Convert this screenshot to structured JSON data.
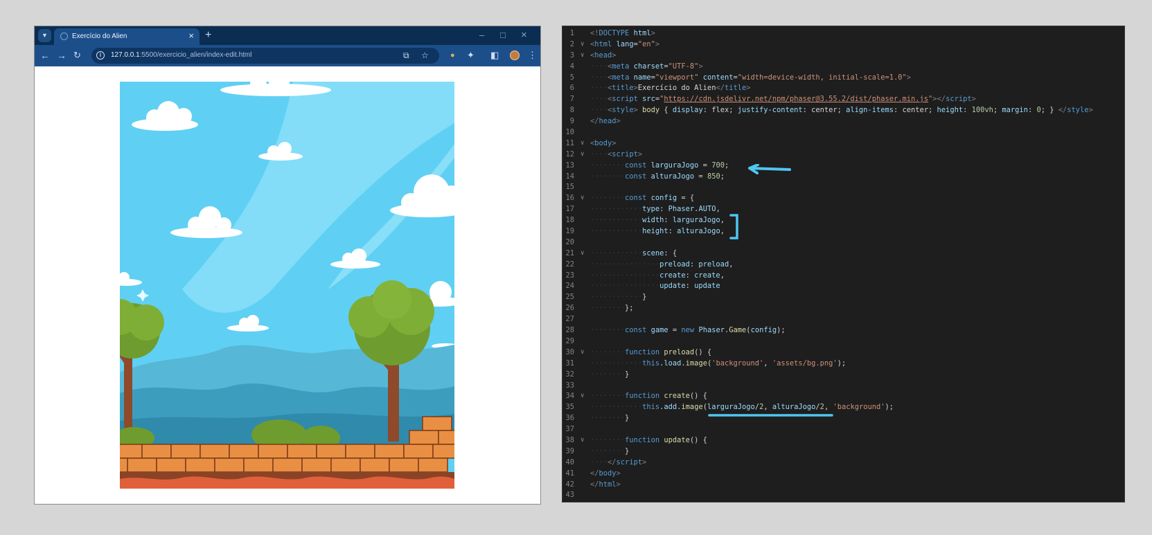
{
  "browser": {
    "tab_title": "Exercício do Alien",
    "url_host": "127.0.0.1",
    "url_rest": ":5500/exercicio_alien/index-edit.html",
    "icons": {
      "tab_menu": "chevron-down-icon",
      "favicon": "globe-icon",
      "tab_close": "close-icon",
      "new_tab": "plus-icon",
      "minimize": "minimize-icon",
      "maximize": "maximize-icon",
      "close_window": "close-icon",
      "back": "arrow-left-icon",
      "forward": "arrow-right-icon",
      "reload": "reload-icon",
      "site_info": "info-icon",
      "translate": "translate-icon",
      "bookmark": "star-icon",
      "extension_pin": "pin-icon",
      "extensions": "puzzle-icon",
      "side_panel": "side-panel-icon",
      "profile": "avatar-icon",
      "menu": "kebab-menu-icon"
    },
    "colors": {
      "tabbar": "#0b2d52",
      "toolbar": "#1c4f8a",
      "sky": "#5fd0f3"
    }
  },
  "editor": {
    "lines": [
      {
        "n": "1",
        "fold": false,
        "indent": 0,
        "tokens": [
          [
            "punc",
            "<!"
          ],
          [
            "tag",
            "DOCTYPE"
          ],
          [
            "plain",
            " "
          ],
          [
            "attr",
            "html"
          ],
          [
            "punc",
            ">"
          ]
        ]
      },
      {
        "n": "2",
        "fold": true,
        "indent": 0,
        "tokens": [
          [
            "punc",
            "<"
          ],
          [
            "tag",
            "html"
          ],
          [
            "plain",
            " "
          ],
          [
            "attr",
            "lang"
          ],
          [
            "plain",
            "="
          ],
          [
            "str",
            "\"en\""
          ],
          [
            "punc",
            ">"
          ]
        ]
      },
      {
        "n": "3",
        "fold": true,
        "indent": 0,
        "tokens": [
          [
            "punc",
            "<"
          ],
          [
            "tag",
            "head"
          ],
          [
            "punc",
            ">"
          ]
        ]
      },
      {
        "n": "4",
        "fold": false,
        "indent": 1,
        "tokens": [
          [
            "punc",
            "<"
          ],
          [
            "tag",
            "meta"
          ],
          [
            "plain",
            " "
          ],
          [
            "attr",
            "charset"
          ],
          [
            "plain",
            "="
          ],
          [
            "str",
            "\"UTF-8\""
          ],
          [
            "punc",
            ">"
          ]
        ]
      },
      {
        "n": "5",
        "fold": false,
        "indent": 1,
        "tokens": [
          [
            "punc",
            "<"
          ],
          [
            "tag",
            "meta"
          ],
          [
            "plain",
            " "
          ],
          [
            "attr",
            "name"
          ],
          [
            "plain",
            "="
          ],
          [
            "str",
            "\"viewport\""
          ],
          [
            "plain",
            " "
          ],
          [
            "attr",
            "content"
          ],
          [
            "plain",
            "="
          ],
          [
            "str",
            "\"width=device-width, initial-scale=1.0\""
          ],
          [
            "punc",
            ">"
          ]
        ]
      },
      {
        "n": "6",
        "fold": false,
        "indent": 1,
        "tokens": [
          [
            "punc",
            "<"
          ],
          [
            "tag",
            "title"
          ],
          [
            "punc",
            ">"
          ],
          [
            "plain",
            "Exercício do Alien"
          ],
          [
            "punc",
            "</"
          ],
          [
            "tag",
            "title"
          ],
          [
            "punc",
            ">"
          ]
        ]
      },
      {
        "n": "7",
        "fold": false,
        "indent": 1,
        "tokens": [
          [
            "punc",
            "<"
          ],
          [
            "tag",
            "script"
          ],
          [
            "plain",
            " "
          ],
          [
            "attr",
            "src"
          ],
          [
            "plain",
            "="
          ],
          [
            "str",
            "\""
          ],
          [
            "url",
            "https://cdn.jsdelivr.net/npm/phaser@3.55.2/dist/phaser.min.js"
          ],
          [
            "str",
            "\""
          ],
          [
            "punc",
            "></"
          ],
          [
            "tag",
            "script"
          ],
          [
            "punc",
            ">"
          ]
        ]
      },
      {
        "n": "8",
        "fold": false,
        "indent": 1,
        "tokens": [
          [
            "punc",
            "<"
          ],
          [
            "tag",
            "style"
          ],
          [
            "punc",
            "> "
          ],
          [
            "fn",
            "body"
          ],
          [
            "plain",
            " { "
          ],
          [
            "attr",
            "display"
          ],
          [
            "plain",
            ": flex; "
          ],
          [
            "attr",
            "justify-content"
          ],
          [
            "plain",
            ": center; "
          ],
          [
            "attr",
            "align-items"
          ],
          [
            "plain",
            ": center; "
          ],
          [
            "attr",
            "height"
          ],
          [
            "plain",
            ": "
          ],
          [
            "num",
            "100vh"
          ],
          [
            "plain",
            "; "
          ],
          [
            "attr",
            "margin"
          ],
          [
            "plain",
            ": "
          ],
          [
            "num",
            "0"
          ],
          [
            "plain",
            "; } "
          ],
          [
            "punc",
            "</"
          ],
          [
            "tag",
            "style"
          ],
          [
            "punc",
            ">"
          ]
        ]
      },
      {
        "n": "9",
        "fold": false,
        "indent": 0,
        "tokens": [
          [
            "punc",
            "</"
          ],
          [
            "tag",
            "head"
          ],
          [
            "punc",
            ">"
          ]
        ]
      },
      {
        "n": "10",
        "fold": false,
        "indent": 0,
        "tokens": []
      },
      {
        "n": "11",
        "fold": true,
        "indent": 0,
        "tokens": [
          [
            "punc",
            "<"
          ],
          [
            "tag",
            "body"
          ],
          [
            "punc",
            ">"
          ]
        ]
      },
      {
        "n": "12",
        "fold": true,
        "indent": 1,
        "tokens": [
          [
            "punc",
            "<"
          ],
          [
            "tag",
            "script"
          ],
          [
            "punc",
            ">"
          ]
        ]
      },
      {
        "n": "13",
        "fold": false,
        "indent": 2,
        "tokens": [
          [
            "kw",
            "const"
          ],
          [
            "plain",
            " "
          ],
          [
            "var",
            "larguraJogo"
          ],
          [
            "plain",
            " = "
          ],
          [
            "num",
            "700"
          ],
          [
            "plain",
            ";"
          ]
        ]
      },
      {
        "n": "14",
        "fold": false,
        "indent": 2,
        "tokens": [
          [
            "kw",
            "const"
          ],
          [
            "plain",
            " "
          ],
          [
            "var",
            "alturaJogo"
          ],
          [
            "plain",
            " = "
          ],
          [
            "num",
            "850"
          ],
          [
            "plain",
            ";"
          ]
        ]
      },
      {
        "n": "15",
        "fold": false,
        "indent": 0,
        "tokens": []
      },
      {
        "n": "16",
        "fold": true,
        "indent": 2,
        "tokens": [
          [
            "kw",
            "const"
          ],
          [
            "plain",
            " "
          ],
          [
            "var",
            "config"
          ],
          [
            "plain",
            " = {"
          ]
        ]
      },
      {
        "n": "17",
        "fold": false,
        "indent": 3,
        "tokens": [
          [
            "var",
            "type"
          ],
          [
            "plain",
            ": "
          ],
          [
            "var",
            "Phaser"
          ],
          [
            "plain",
            "."
          ],
          [
            "var",
            "AUTO"
          ],
          [
            "plain",
            ","
          ]
        ]
      },
      {
        "n": "18",
        "fold": false,
        "indent": 3,
        "tokens": [
          [
            "var",
            "width"
          ],
          [
            "plain",
            ": "
          ],
          [
            "var",
            "larguraJogo"
          ],
          [
            "plain",
            ","
          ]
        ]
      },
      {
        "n": "19",
        "fold": false,
        "indent": 3,
        "tokens": [
          [
            "var",
            "height"
          ],
          [
            "plain",
            ": "
          ],
          [
            "var",
            "alturaJogo"
          ],
          [
            "plain",
            ","
          ]
        ]
      },
      {
        "n": "20",
        "fold": false,
        "indent": 0,
        "tokens": []
      },
      {
        "n": "21",
        "fold": true,
        "indent": 3,
        "tokens": [
          [
            "var",
            "scene"
          ],
          [
            "plain",
            ": {"
          ]
        ]
      },
      {
        "n": "22",
        "fold": false,
        "indent": 4,
        "tokens": [
          [
            "var",
            "preload"
          ],
          [
            "plain",
            ": "
          ],
          [
            "var",
            "preload"
          ],
          [
            "plain",
            ","
          ]
        ]
      },
      {
        "n": "23",
        "fold": false,
        "indent": 4,
        "tokens": [
          [
            "var",
            "create"
          ],
          [
            "plain",
            ": "
          ],
          [
            "var",
            "create"
          ],
          [
            "plain",
            ","
          ]
        ]
      },
      {
        "n": "24",
        "fold": false,
        "indent": 4,
        "tokens": [
          [
            "var",
            "update"
          ],
          [
            "plain",
            ": "
          ],
          [
            "var",
            "update"
          ]
        ]
      },
      {
        "n": "25",
        "fold": false,
        "indent": 3,
        "tokens": [
          [
            "plain",
            "}"
          ]
        ]
      },
      {
        "n": "26",
        "fold": false,
        "indent": 2,
        "tokens": [
          [
            "plain",
            "};"
          ]
        ]
      },
      {
        "n": "27",
        "fold": false,
        "indent": 0,
        "tokens": []
      },
      {
        "n": "28",
        "fold": false,
        "indent": 2,
        "tokens": [
          [
            "kw",
            "const"
          ],
          [
            "plain",
            " "
          ],
          [
            "var",
            "game"
          ],
          [
            "plain",
            " = "
          ],
          [
            "kw",
            "new"
          ],
          [
            "plain",
            " "
          ],
          [
            "var",
            "Phaser"
          ],
          [
            "plain",
            "."
          ],
          [
            "fn",
            "Game"
          ],
          [
            "plain",
            "("
          ],
          [
            "var",
            "config"
          ],
          [
            "plain",
            ");"
          ]
        ]
      },
      {
        "n": "29",
        "fold": false,
        "indent": 0,
        "tokens": []
      },
      {
        "n": "30",
        "fold": true,
        "indent": 2,
        "tokens": [
          [
            "kw",
            "function"
          ],
          [
            "plain",
            " "
          ],
          [
            "fn",
            "preload"
          ],
          [
            "plain",
            "() {"
          ]
        ]
      },
      {
        "n": "31",
        "fold": false,
        "indent": 3,
        "tokens": [
          [
            "kw",
            "this"
          ],
          [
            "plain",
            "."
          ],
          [
            "var",
            "load"
          ],
          [
            "plain",
            "."
          ],
          [
            "fn",
            "image"
          ],
          [
            "plain",
            "("
          ],
          [
            "str",
            "'background'"
          ],
          [
            "plain",
            ", "
          ],
          [
            "str",
            "'assets/bg.png'"
          ],
          [
            "plain",
            ");"
          ]
        ]
      },
      {
        "n": "32",
        "fold": false,
        "indent": 2,
        "tokens": [
          [
            "plain",
            "}"
          ]
        ]
      },
      {
        "n": "33",
        "fold": false,
        "indent": 0,
        "tokens": []
      },
      {
        "n": "34",
        "fold": true,
        "indent": 2,
        "tokens": [
          [
            "kw",
            "function"
          ],
          [
            "plain",
            " "
          ],
          [
            "fn",
            "create"
          ],
          [
            "plain",
            "() {"
          ]
        ]
      },
      {
        "n": "35",
        "fold": false,
        "indent": 3,
        "tokens": [
          [
            "kw",
            "this"
          ],
          [
            "plain",
            "."
          ],
          [
            "var",
            "add"
          ],
          [
            "plain",
            "."
          ],
          [
            "fn",
            "image"
          ],
          [
            "plain",
            "("
          ],
          [
            "var",
            "larguraJogo"
          ],
          [
            "plain",
            "/"
          ],
          [
            "num",
            "2"
          ],
          [
            "plain",
            ", "
          ],
          [
            "var",
            "alturaJogo"
          ],
          [
            "plain",
            "/"
          ],
          [
            "num",
            "2"
          ],
          [
            "plain",
            ", "
          ],
          [
            "str",
            "'background'"
          ],
          [
            "plain",
            ");"
          ]
        ]
      },
      {
        "n": "36",
        "fold": false,
        "indent": 2,
        "tokens": [
          [
            "plain",
            "}"
          ]
        ]
      },
      {
        "n": "37",
        "fold": false,
        "indent": 0,
        "tokens": []
      },
      {
        "n": "38",
        "fold": true,
        "indent": 2,
        "tokens": [
          [
            "kw",
            "function"
          ],
          [
            "plain",
            " "
          ],
          [
            "fn",
            "update"
          ],
          [
            "plain",
            "() {"
          ]
        ]
      },
      {
        "n": "39",
        "fold": false,
        "indent": 2,
        "tokens": [
          [
            "plain",
            "}"
          ]
        ]
      },
      {
        "n": "40",
        "fold": false,
        "indent": 1,
        "tokens": [
          [
            "punc",
            "</"
          ],
          [
            "tag",
            "script"
          ],
          [
            "punc",
            ">"
          ]
        ]
      },
      {
        "n": "41",
        "fold": false,
        "indent": 0,
        "tokens": [
          [
            "punc",
            "</"
          ],
          [
            "tag",
            "body"
          ],
          [
            "punc",
            ">"
          ]
        ]
      },
      {
        "n": "42",
        "fold": false,
        "indent": 0,
        "tokens": [
          [
            "punc",
            "</"
          ],
          [
            "tag",
            "html"
          ],
          [
            "punc",
            ">"
          ]
        ]
      },
      {
        "n": "43",
        "fold": false,
        "indent": 0,
        "tokens": []
      }
    ],
    "annotations": {
      "arrow": "arrow-left-icon",
      "bracket": "bracket-icon",
      "underline": "underline-mark",
      "color": "#4fc6f2"
    }
  }
}
